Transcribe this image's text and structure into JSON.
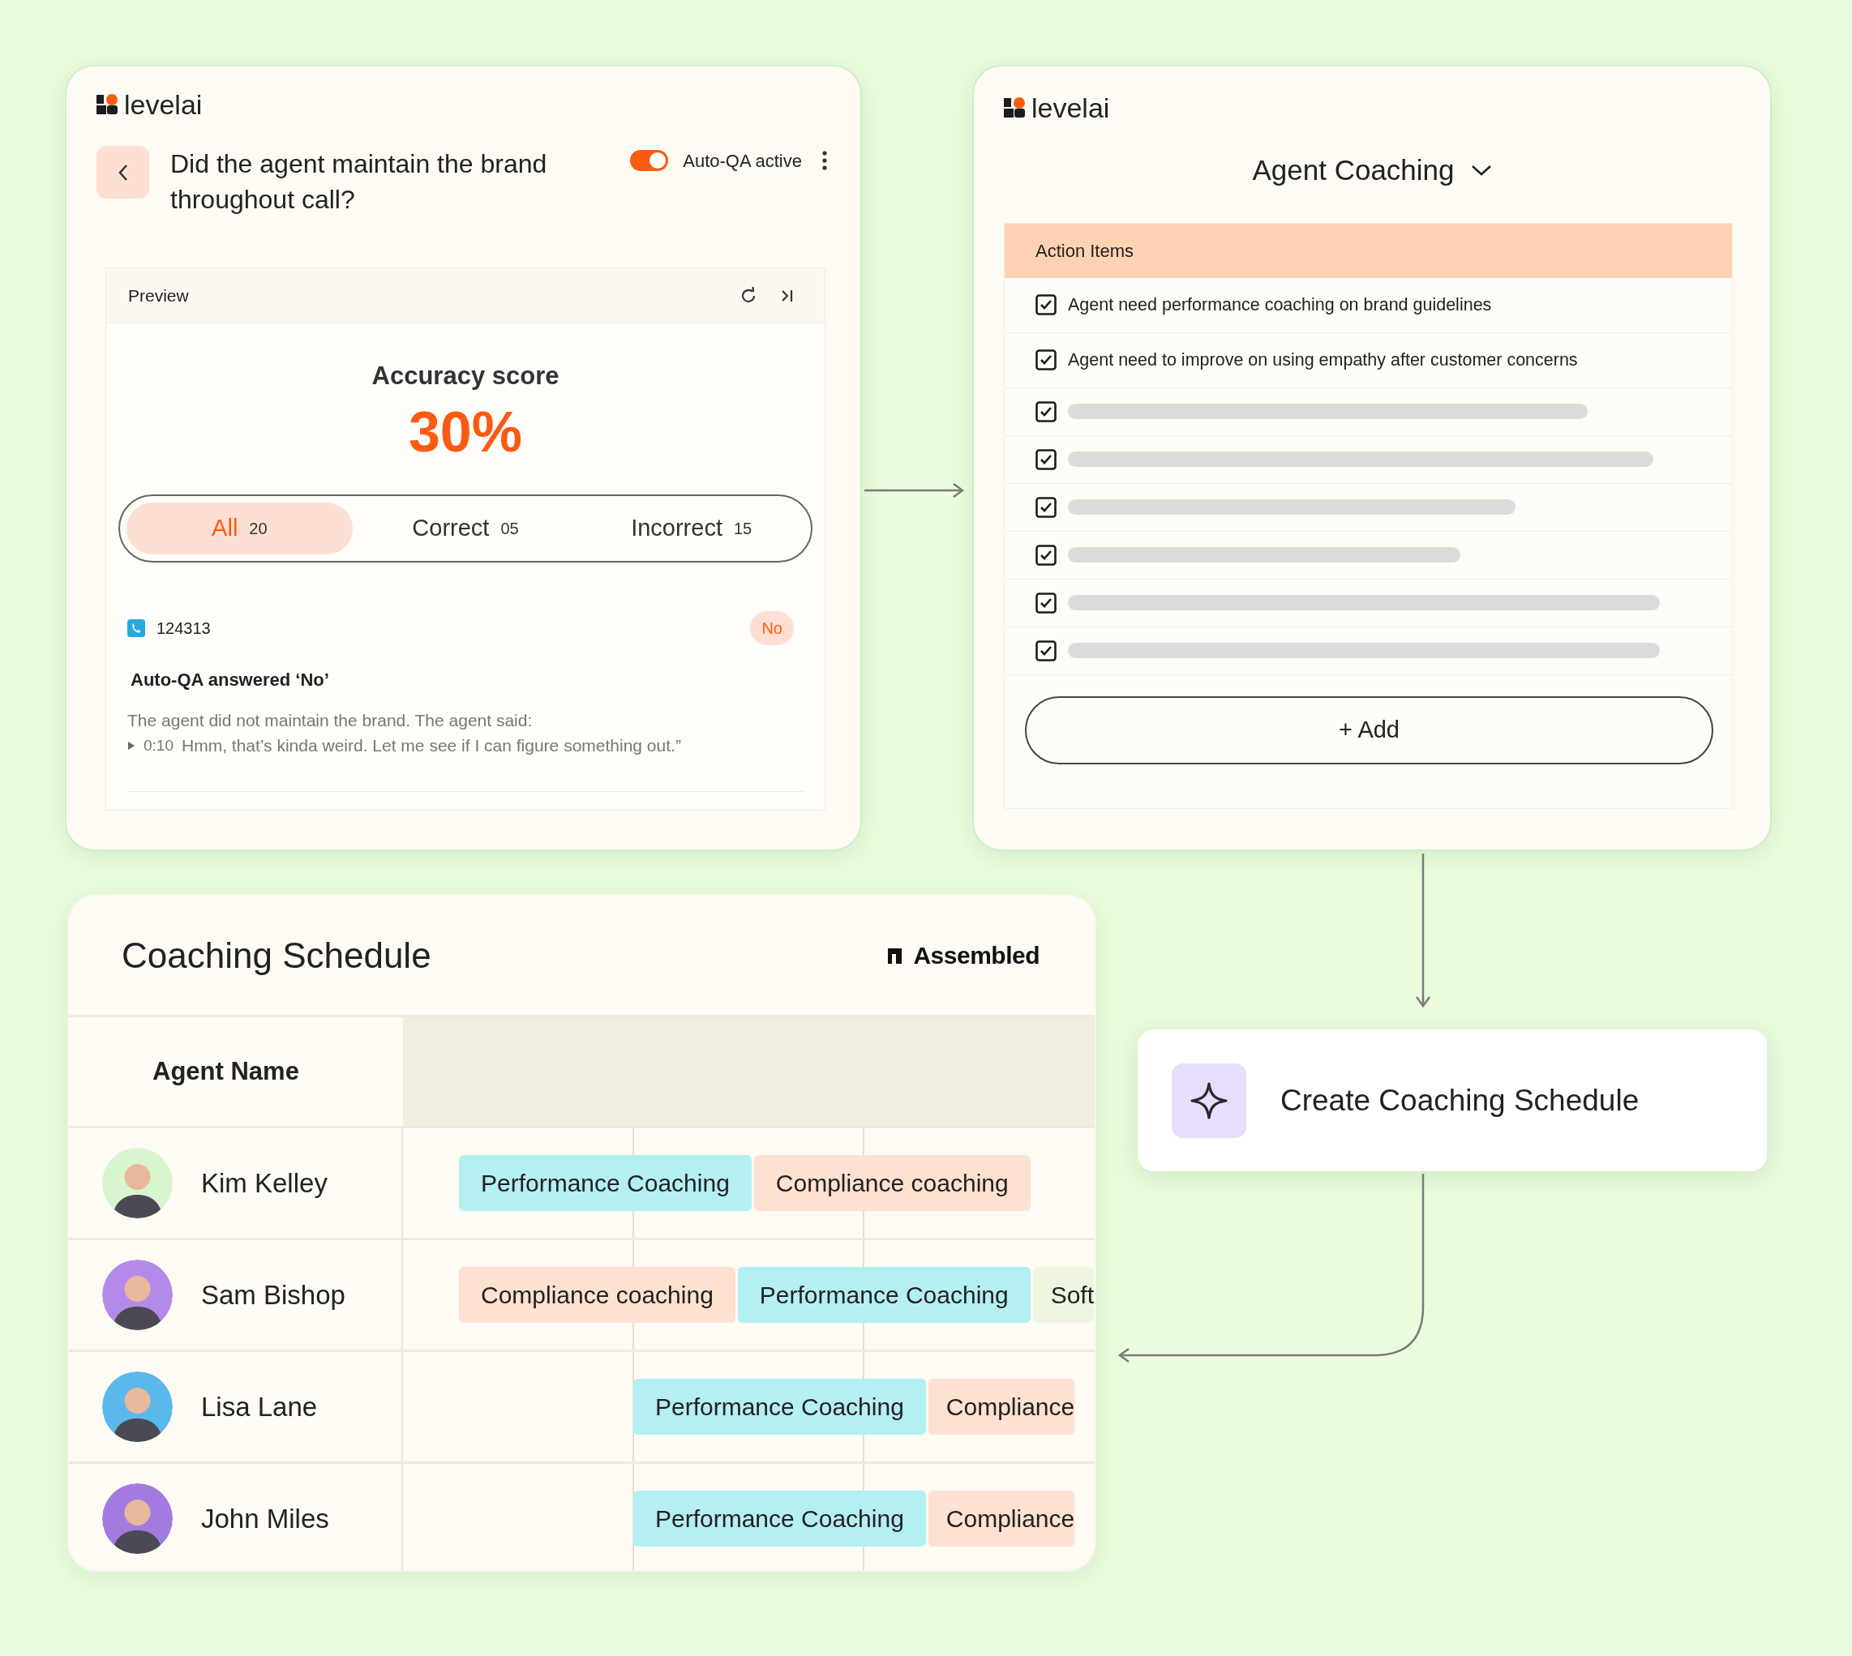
{
  "qa_card": {
    "logo": "levelai",
    "question": "Did the agent maintain the brand throughout call?",
    "auto_qa": {
      "on": true,
      "label": "Auto-QA active"
    },
    "preview": {
      "title": "Preview",
      "score_label": "Accuracy score",
      "score": "30%",
      "filters": [
        {
          "label": "All",
          "count": "20",
          "selected": true
        },
        {
          "label": "Correct",
          "count": "05",
          "selected": false
        },
        {
          "label": "Incorrect",
          "count": "15",
          "selected": false
        }
      ],
      "result": {
        "call_id": "124313",
        "answer_badge": "No",
        "heading": "Auto-QA answered ‘No’",
        "explanation": "The agent did not maintain the brand. The agent said:",
        "timestamp": "0:10",
        "quote": "Hmm, that’s kinda weird. Let me see if I can figure something out.”"
      }
    }
  },
  "coaching_card": {
    "logo": "levelai",
    "title": "Agent Coaching",
    "action_items": {
      "title": "Action Items",
      "items": [
        {
          "kind": "text",
          "text": "Agent need performance coaching on brand guidelines",
          "checked": true
        },
        {
          "kind": "text",
          "text": "Agent need to improve on using empathy after customer concerns",
          "checked": true
        },
        {
          "kind": "skeleton",
          "checked": true
        },
        {
          "kind": "skeleton",
          "checked": true
        },
        {
          "kind": "skeleton",
          "checked": true
        },
        {
          "kind": "skeleton",
          "checked": true
        },
        {
          "kind": "skeleton",
          "checked": true
        },
        {
          "kind": "skeleton",
          "checked": true
        }
      ]
    },
    "add_button": "+ Add"
  },
  "schedule": {
    "title": "Coaching Schedule",
    "brand": "Assembled",
    "columns": [
      "Agent Name"
    ],
    "rows": [
      {
        "name": "Kim Kelley",
        "sessions": [
          {
            "label": "Performance Coaching",
            "color": "#b4eff2"
          },
          {
            "label": "Compliance coaching",
            "color": "#fde1d1"
          }
        ]
      },
      {
        "name": "Sam Bishop",
        "sessions": [
          {
            "label": "Compliance coaching",
            "color": "#fde1d1"
          },
          {
            "label": "Performance Coaching",
            "color": "#b4eff2"
          },
          {
            "label": "Soft",
            "color": "#eef6e0"
          }
        ]
      },
      {
        "name": "Lisa Lane",
        "sessions": [
          {
            "label": "Performance Coaching",
            "color": "#b4eff2"
          },
          {
            "label": "Compliance",
            "color": "#fde1d1"
          }
        ]
      },
      {
        "name": "John Miles",
        "sessions": [
          {
            "label": "Performance Coaching",
            "color": "#b4eff2"
          },
          {
            "label": "Compliance",
            "color": "#fde1d1"
          }
        ]
      }
    ]
  },
  "action_button": "Create Coaching Schedule"
}
